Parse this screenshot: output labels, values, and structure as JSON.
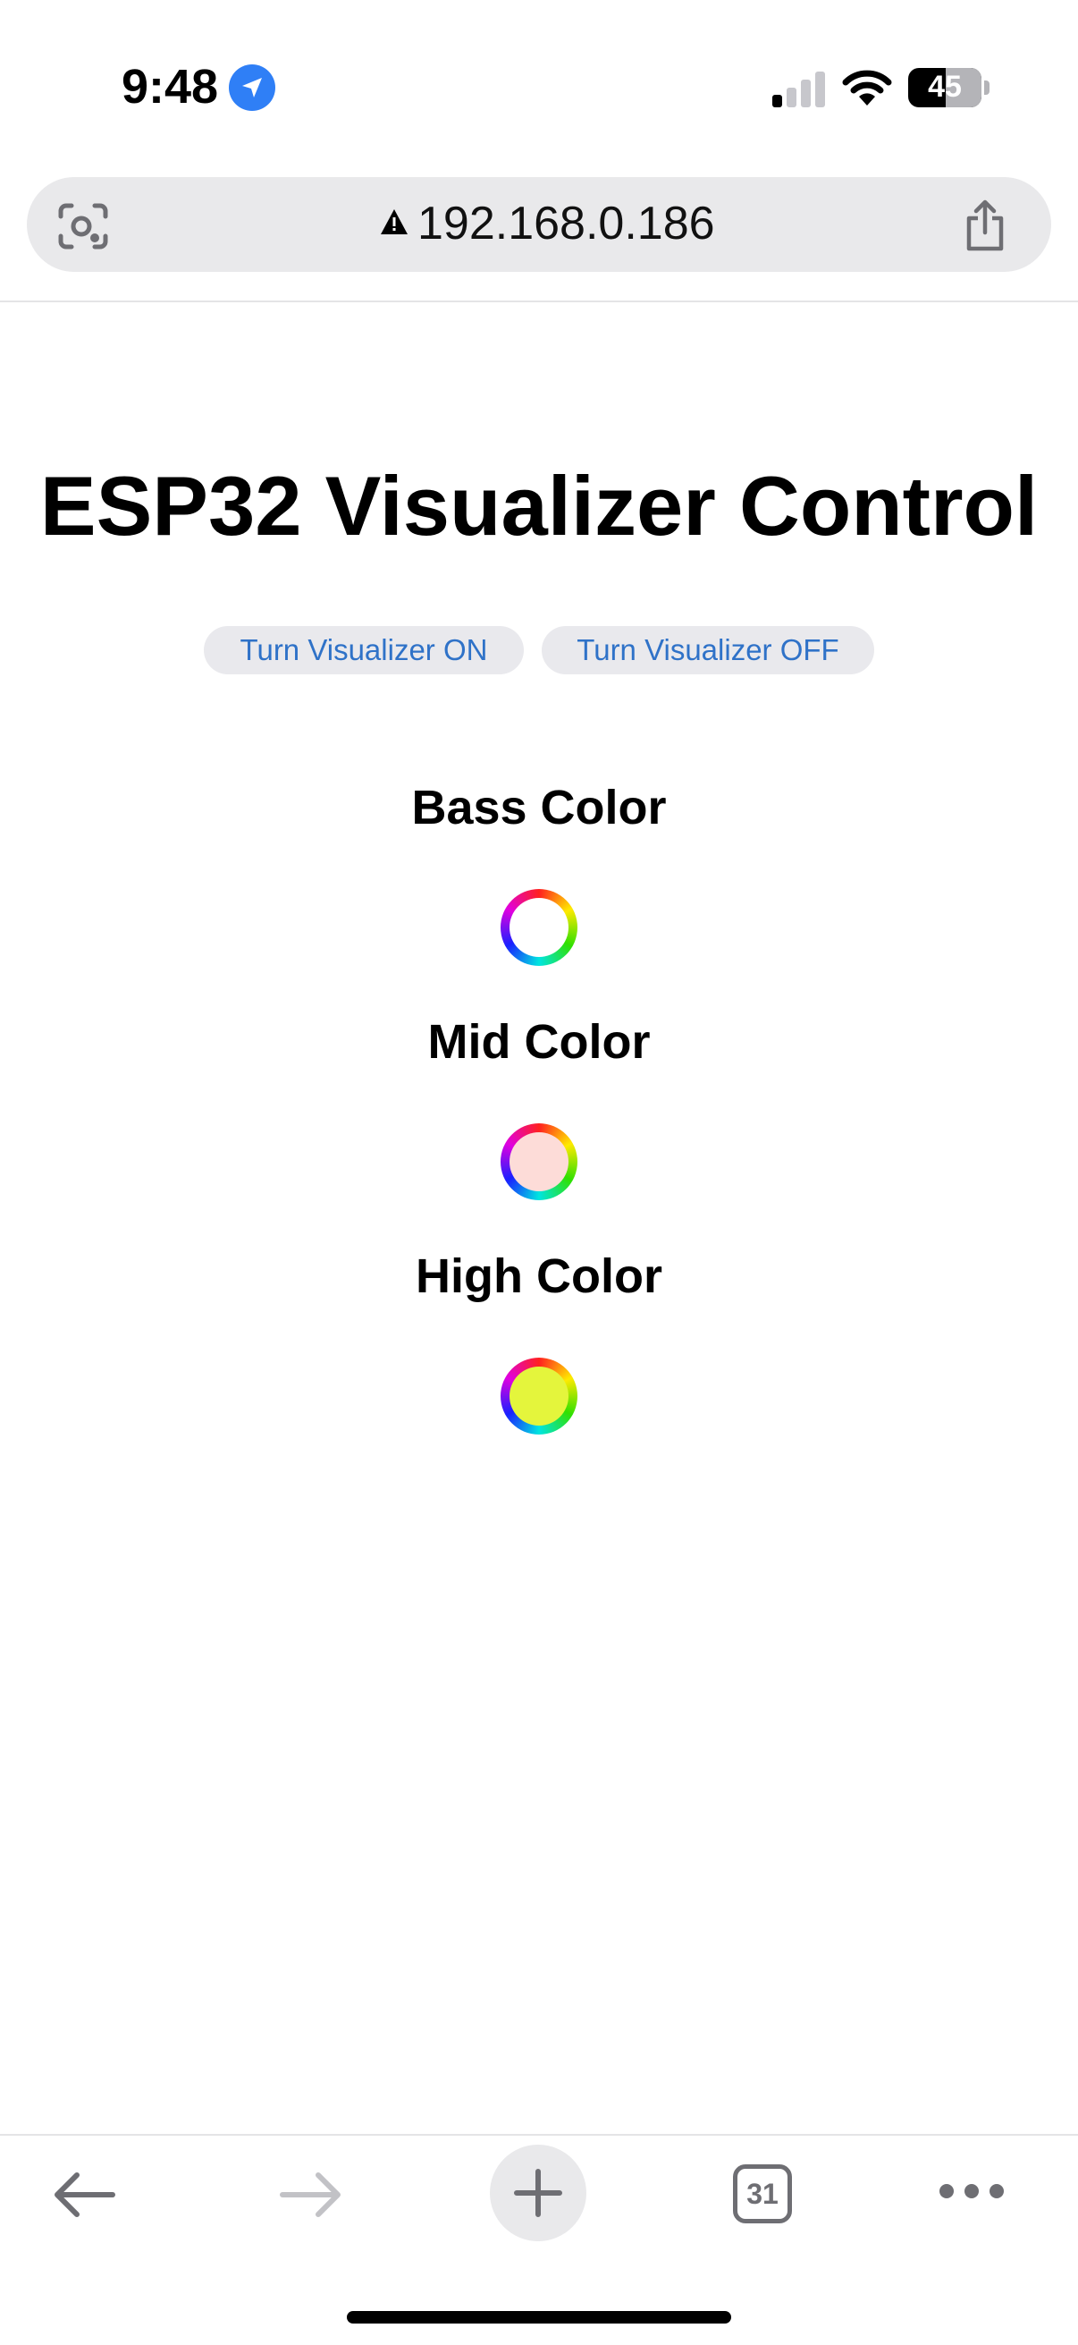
{
  "status_bar": {
    "time": "9:48",
    "battery_percent": "45",
    "location_icon": "location-arrow-icon",
    "signal_icon": "cellular-signal-icon",
    "wifi_icon": "wifi-icon"
  },
  "browser": {
    "url": "192.168.0.186",
    "security_icon": "warning-triangle-icon",
    "tab_count": "31"
  },
  "page": {
    "title": "ESP32 Visualizer Control",
    "buttons": {
      "on_label": "Turn Visualizer ON",
      "off_label": "Turn Visualizer OFF"
    },
    "colors": [
      {
        "label": "Bass Color",
        "value": "#ffffff"
      },
      {
        "label": "Mid Color",
        "value": "#fddcd8"
      },
      {
        "label": "High Color",
        "value": "#e4f53c"
      }
    ]
  },
  "theme": {
    "link_blue": "#2f72c8",
    "location_blue": "#2f7ff6"
  }
}
